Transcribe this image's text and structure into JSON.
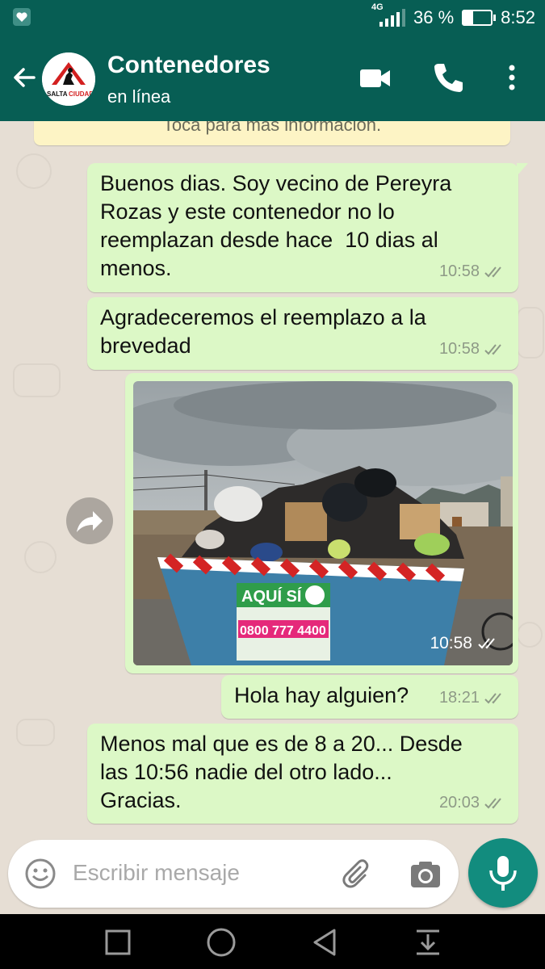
{
  "status_bar": {
    "network": "4G",
    "battery_level_percent": 36,
    "battery_text": "36 %",
    "time": "8:52"
  },
  "header": {
    "avatar_label_left": "SALTA",
    "avatar_label_right": "CIUDAD",
    "title": "Contenedores",
    "subtitle": "en línea"
  },
  "chat": {
    "notice": "Toca para más información.",
    "messages": [
      {
        "text": "Buenos dias. Soy vecino de Pereyra\nRozas y este contenedor no lo\nreemplazan desde hace  10 dias al\nmenos.",
        "time": "10:58"
      },
      {
        "text": "Agradeceremos el reemplazo a la\nbrevedad",
        "time": "10:58"
      },
      {
        "image_sign_brand": "AQUÍ SÍ",
        "image_sign_phone": "0800 777 4400",
        "time": "10:58"
      },
      {
        "text": "Hola hay alguien?",
        "time": "18:21"
      },
      {
        "text": "Menos mal que es de 8 a 20... Desde\nlas 10:56 nadie del otro lado...\nGracias.",
        "time": "20:03"
      }
    ]
  },
  "composer": {
    "placeholder": "Escribir mensaje"
  },
  "colors": {
    "header_bg": "#075e54",
    "bubble_out": "#dcf8c6",
    "fab": "#128c7e",
    "chat_bg": "#e6ded4"
  }
}
